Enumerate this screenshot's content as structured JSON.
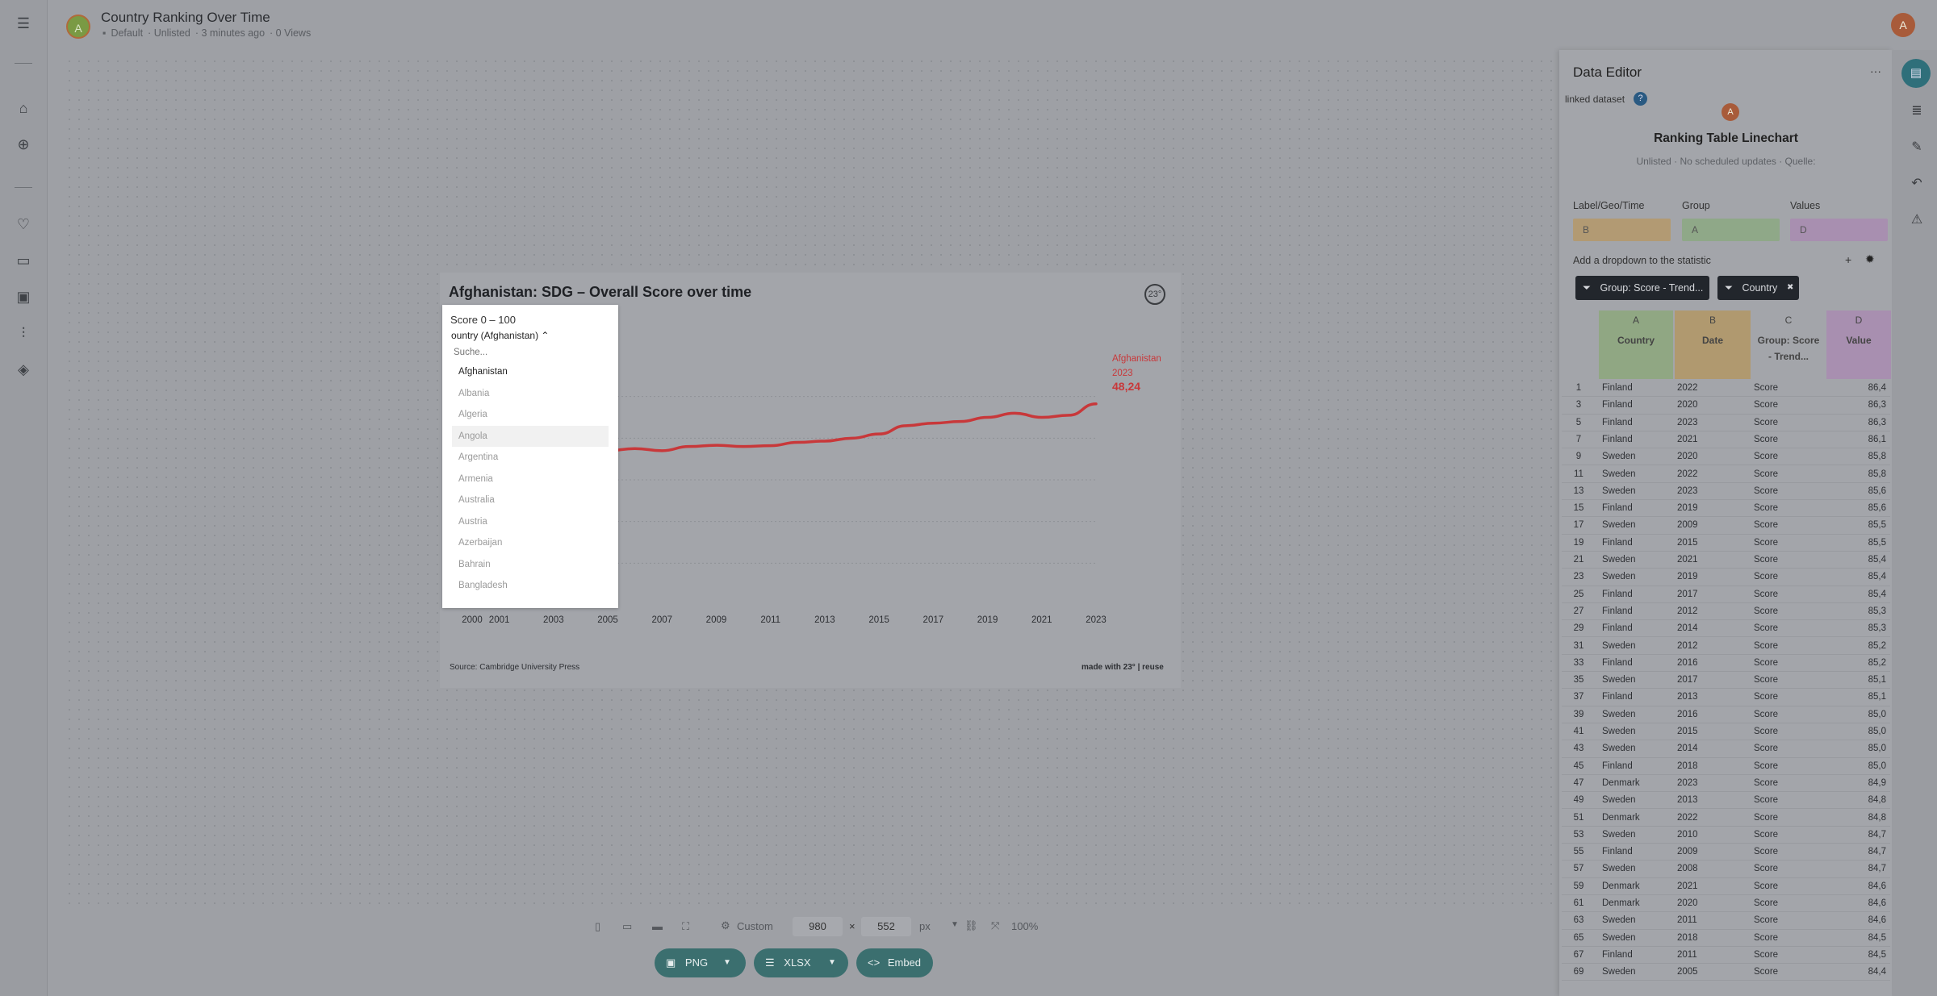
{
  "header": {
    "avatar_letter": "A",
    "title": "Country Ranking Over Time",
    "folder": "Default",
    "visibility": "Unlisted",
    "edited": "3 minutes ago",
    "views": "0 Views",
    "user_avatar_letter": "A"
  },
  "nav": {
    "icons": [
      "menu-icon",
      "home-icon",
      "add-icon",
      "heart-icon",
      "folder-icon",
      "image-icon",
      "sliders-icon",
      "layers-icon"
    ]
  },
  "chart": {
    "title": "Afghanistan: SDG – Overall Score over time",
    "logo": "23°",
    "source": "Source: Cambridge University Press",
    "made_with": "made with 23° | reuse",
    "label_country": "Afghanistan",
    "label_year": "2023",
    "label_value": "48,24",
    "line_color": "#c8383a"
  },
  "chart_data": {
    "type": "line",
    "x_ticks": [
      "2000",
      "2001",
      "2003",
      "2005",
      "2007",
      "2009",
      "2011",
      "2013",
      "2015",
      "2017",
      "2019",
      "2021",
      "2023"
    ],
    "series": [
      {
        "name": "Afghanistan",
        "x": [
          2000,
          2001,
          2002,
          2003,
          2004,
          2005,
          2006,
          2007,
          2008,
          2009,
          2010,
          2011,
          2012,
          2013,
          2014,
          2015,
          2016,
          2017,
          2018,
          2019,
          2020,
          2021,
          2022,
          2023
        ],
        "values": [
          36.0,
          36.2,
          36.5,
          36.8,
          36.4,
          37.0,
          37.5,
          37.0,
          38.0,
          38.3,
          38.0,
          38.2,
          39.0,
          39.3,
          40.0,
          41.0,
          43.0,
          43.6,
          44.0,
          45.0,
          46.0,
          45.0,
          45.5,
          48.24
        ]
      }
    ]
  },
  "dropdown": {
    "score_label": "Score 0 – 100",
    "toggle_label": "ountry (Afghanistan) ⌃",
    "search_placeholder": "Suche...",
    "items": [
      "Afghanistan",
      "Albania",
      "Algeria",
      "Angola",
      "Argentina",
      "Armenia",
      "Australia",
      "Austria",
      "Azerbaijan",
      "Bahrain",
      "Bangladesh"
    ],
    "selected": "Afghanistan",
    "highlighted": "Angola"
  },
  "toolbar": {
    "preset_label": "Custom",
    "width": "980",
    "times": "×",
    "height": "552",
    "unit": "px",
    "zoom": "100%",
    "png_label": "PNG",
    "xlsx_label": "XLSX",
    "embed_label": "Embed"
  },
  "editor": {
    "title": "Data Editor",
    "more": "···",
    "linked_label": "linked dataset",
    "help": "?",
    "dataset_avatar": "A",
    "dataset_title": "Ranking Table Linechart",
    "dataset_meta": "Unlisted · No scheduled updates · Quelle:",
    "mapping": [
      {
        "label": "Label/Geo/Time",
        "value": "B",
        "color": "#b29a73"
      },
      {
        "label": "Group",
        "value": "A",
        "color": "#8fa888"
      },
      {
        "label": "Values",
        "value": "D",
        "color": "#a88fb0"
      }
    ],
    "add_dropdown": "Add a dropdown to the statistic",
    "add_plus": "+",
    "filters": [
      "Group: Score - Trend...",
      "Country"
    ],
    "filter_close": "✖",
    "columns": [
      {
        "letter": "A",
        "name": "Country",
        "color": "#90a783"
      },
      {
        "letter": "B",
        "name": "Date",
        "color": "#b0996f"
      },
      {
        "letter": "C",
        "name": "Group: Score - Trend...",
        "color": "#a3a5aa"
      },
      {
        "letter": "D",
        "name": "Value",
        "color": "#a88fb0"
      }
    ],
    "rows": [
      [
        "1",
        "Finland",
        "2022",
        "Score",
        "86,4"
      ],
      [
        "3",
        "Finland",
        "2020",
        "Score",
        "86,3"
      ],
      [
        "5",
        "Finland",
        "2023",
        "Score",
        "86,3"
      ],
      [
        "7",
        "Finland",
        "2021",
        "Score",
        "86,1"
      ],
      [
        "9",
        "Sweden",
        "2020",
        "Score",
        "85,8"
      ],
      [
        "11",
        "Sweden",
        "2022",
        "Score",
        "85,8"
      ],
      [
        "13",
        "Sweden",
        "2023",
        "Score",
        "85,6"
      ],
      [
        "15",
        "Finland",
        "2019",
        "Score",
        "85,6"
      ],
      [
        "17",
        "Sweden",
        "2009",
        "Score",
        "85,5"
      ],
      [
        "19",
        "Finland",
        "2015",
        "Score",
        "85,5"
      ],
      [
        "21",
        "Sweden",
        "2021",
        "Score",
        "85,4"
      ],
      [
        "23",
        "Sweden",
        "2019",
        "Score",
        "85,4"
      ],
      [
        "25",
        "Finland",
        "2017",
        "Score",
        "85,4"
      ],
      [
        "27",
        "Finland",
        "2012",
        "Score",
        "85,3"
      ],
      [
        "29",
        "Finland",
        "2014",
        "Score",
        "85,3"
      ],
      [
        "31",
        "Sweden",
        "2012",
        "Score",
        "85,2"
      ],
      [
        "33",
        "Finland",
        "2016",
        "Score",
        "85,2"
      ],
      [
        "35",
        "Sweden",
        "2017",
        "Score",
        "85,1"
      ],
      [
        "37",
        "Finland",
        "2013",
        "Score",
        "85,1"
      ],
      [
        "39",
        "Sweden",
        "2016",
        "Score",
        "85,0"
      ],
      [
        "41",
        "Sweden",
        "2015",
        "Score",
        "85,0"
      ],
      [
        "43",
        "Sweden",
        "2014",
        "Score",
        "85,0"
      ],
      [
        "45",
        "Finland",
        "2018",
        "Score",
        "85,0"
      ],
      [
        "47",
        "Denmark",
        "2023",
        "Score",
        "84,9"
      ],
      [
        "49",
        "Sweden",
        "2013",
        "Score",
        "84,8"
      ],
      [
        "51",
        "Denmark",
        "2022",
        "Score",
        "84,8"
      ],
      [
        "53",
        "Sweden",
        "2010",
        "Score",
        "84,7"
      ],
      [
        "55",
        "Finland",
        "2009",
        "Score",
        "84,7"
      ],
      [
        "57",
        "Sweden",
        "2008",
        "Score",
        "84,7"
      ],
      [
        "59",
        "Denmark",
        "2021",
        "Score",
        "84,6"
      ],
      [
        "61",
        "Denmark",
        "2020",
        "Score",
        "84,6"
      ],
      [
        "63",
        "Sweden",
        "2011",
        "Score",
        "84,6"
      ],
      [
        "65",
        "Sweden",
        "2018",
        "Score",
        "84,5"
      ],
      [
        "67",
        "Finland",
        "2011",
        "Score",
        "84,5"
      ],
      [
        "69",
        "Sweden",
        "2005",
        "Score",
        "84,4"
      ]
    ]
  }
}
